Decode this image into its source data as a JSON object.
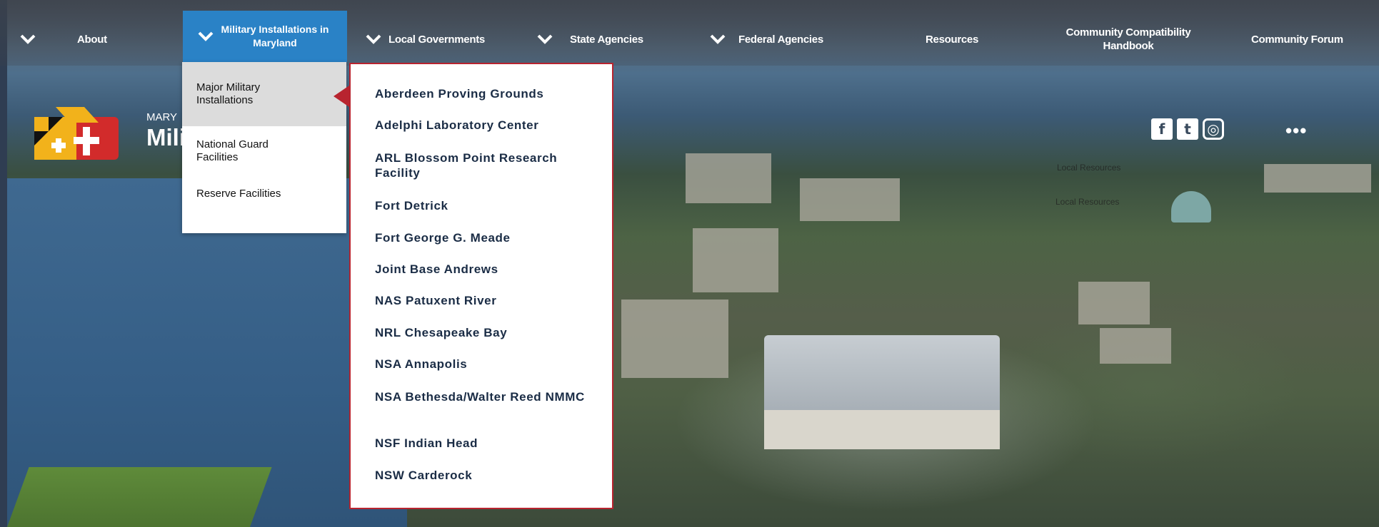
{
  "nav": {
    "about": "About",
    "military_installations": "Military Installations in Maryland",
    "local_governments": "Local Governments",
    "state_agencies": "State Agencies",
    "federal_agencies": "Federal Agencies",
    "resources": "Resources",
    "community_handbook": "Community Compatibility Handbook",
    "community_forum": "Community Forum"
  },
  "submenu": {
    "items": [
      {
        "label": "Major Military Installations"
      },
      {
        "label": "National Guard Facilities"
      },
      {
        "label": "Reserve Facilities"
      }
    ]
  },
  "major_installations": {
    "items": [
      "Aberdeen Proving Grounds",
      "Adelphi Laboratory Center",
      "ARL Blossom Point Research Facility",
      "Fort Detrick",
      "Fort George G. Meade",
      "Joint Base Andrews",
      "NAS Patuxent River",
      "NRL Chesapeake Bay",
      "NSA Annapolis",
      "NSA Bethesda/Walter Reed NMMC",
      "NSF Indian Head",
      "NSW Carderock"
    ]
  },
  "brand": {
    "line1": "MARY",
    "line2": "Mili"
  },
  "social": {
    "facebook_icon": "f",
    "twitter_icon": "t",
    "instagram_icon": "◎",
    "more": "•••"
  },
  "background_text": {
    "local_resources_1": "Local Resources",
    "local_resources_2": "Local Resources"
  },
  "colors": {
    "accent_blue": "#2a82c6",
    "accent_red": "#b8242f",
    "link_navy": "#1a2c45"
  }
}
